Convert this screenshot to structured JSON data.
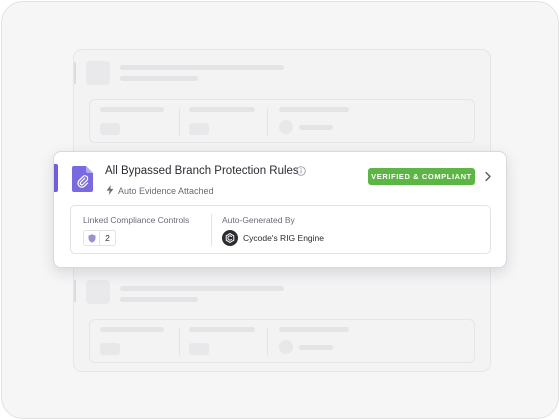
{
  "card": {
    "title": "All Bypassed Branch Protection Rules",
    "subtitle": "Auto Evidence Attached",
    "status_badge": "VERIFIED & COMPLIANT",
    "accent_color": "#6f5fdb",
    "badge_color": "#5cb544",
    "icons": {
      "document": "paperclip-document-icon",
      "info": "info-icon",
      "subtitle": "bolt-icon",
      "open": "chevron-right-icon",
      "controls": "shield-icon",
      "engine": "cycode-logo-icon"
    }
  },
  "details": {
    "linked_controls_label": "Linked Compliance Controls",
    "linked_controls_count": "2",
    "auto_generated_label": "Auto-Generated By",
    "engine_name": "Cycode's RIG Engine"
  }
}
